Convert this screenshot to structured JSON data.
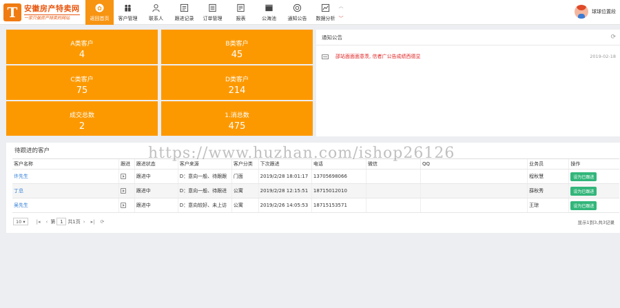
{
  "brand": {
    "title": "安徽房产特卖网",
    "subtitle": "一家只做房产特卖的网站",
    "logo_letter": "T"
  },
  "nav": {
    "items": [
      {
        "label": "返回首页",
        "icon": "home-icon",
        "active": true
      },
      {
        "label": "客户管理",
        "icon": "users-icon"
      },
      {
        "label": "联系人",
        "icon": "user-icon"
      },
      {
        "label": "跟进记录",
        "icon": "list-icon"
      },
      {
        "label": "订单管理",
        "icon": "order-icon"
      },
      {
        "label": "报表",
        "icon": "report-icon"
      },
      {
        "label": "公海池",
        "icon": "pool-icon"
      },
      {
        "label": "通知公告",
        "icon": "notice-icon"
      },
      {
        "label": "数据分析",
        "icon": "chart-icon"
      }
    ]
  },
  "user": {
    "name": "球球位置段"
  },
  "tiles": [
    {
      "label": "A类客户",
      "value": "4"
    },
    {
      "label": "B类客户",
      "value": "45"
    },
    {
      "label": "C类客户",
      "value": "75"
    },
    {
      "label": "D类客户",
      "value": "214"
    },
    {
      "label": "成交总数",
      "value": "2"
    },
    {
      "label": "1.消总数",
      "value": "475"
    }
  ],
  "notice": {
    "title": "通知公告",
    "items": [
      {
        "text": "邵站面面面意羡, 信者广公告成绩西德显",
        "date": "2019-02-18"
      }
    ]
  },
  "pending": {
    "title": "待跟进的客户",
    "columns": [
      "客户名称",
      "跟进",
      "跟进状态",
      "客户来源",
      "客户分类",
      "下次跟进",
      "电话",
      "微信",
      "QQ",
      "业务员",
      "操作"
    ],
    "rows": [
      {
        "name": "许先生",
        "status": "跟进中",
        "source": "D：意向一般、待跟跟",
        "category": "门面",
        "next": "2019/2/28 18:01:17",
        "phone": "13705698066",
        "wechat": "",
        "qq": "",
        "owner": "程秋慧",
        "action": "设为已跟进"
      },
      {
        "name": "丁总",
        "status": "跟进中",
        "source": "D：意向一般、待跟进",
        "category": "公寓",
        "next": "2019/2/28 12:15:51",
        "phone": "18715012010",
        "wechat": "",
        "qq": "",
        "owner": "薛秋秀",
        "action": "设为已跟进"
      },
      {
        "name": "吴先生",
        "status": "跟进中",
        "source": "D：意向较好、未上访",
        "category": "公寓",
        "next": "2019/2/26 14:05:53",
        "phone": "18715153571",
        "wechat": "",
        "qq": "",
        "owner": "王琼",
        "action": "设为已跟进"
      }
    ],
    "pager": {
      "page_size": "10",
      "page_prefix": "第",
      "page": "1",
      "page_suffix": "共1页",
      "info": "显示1到3,共3记录"
    }
  },
  "watermark": "https://www.huzhan.com/ishop26126"
}
